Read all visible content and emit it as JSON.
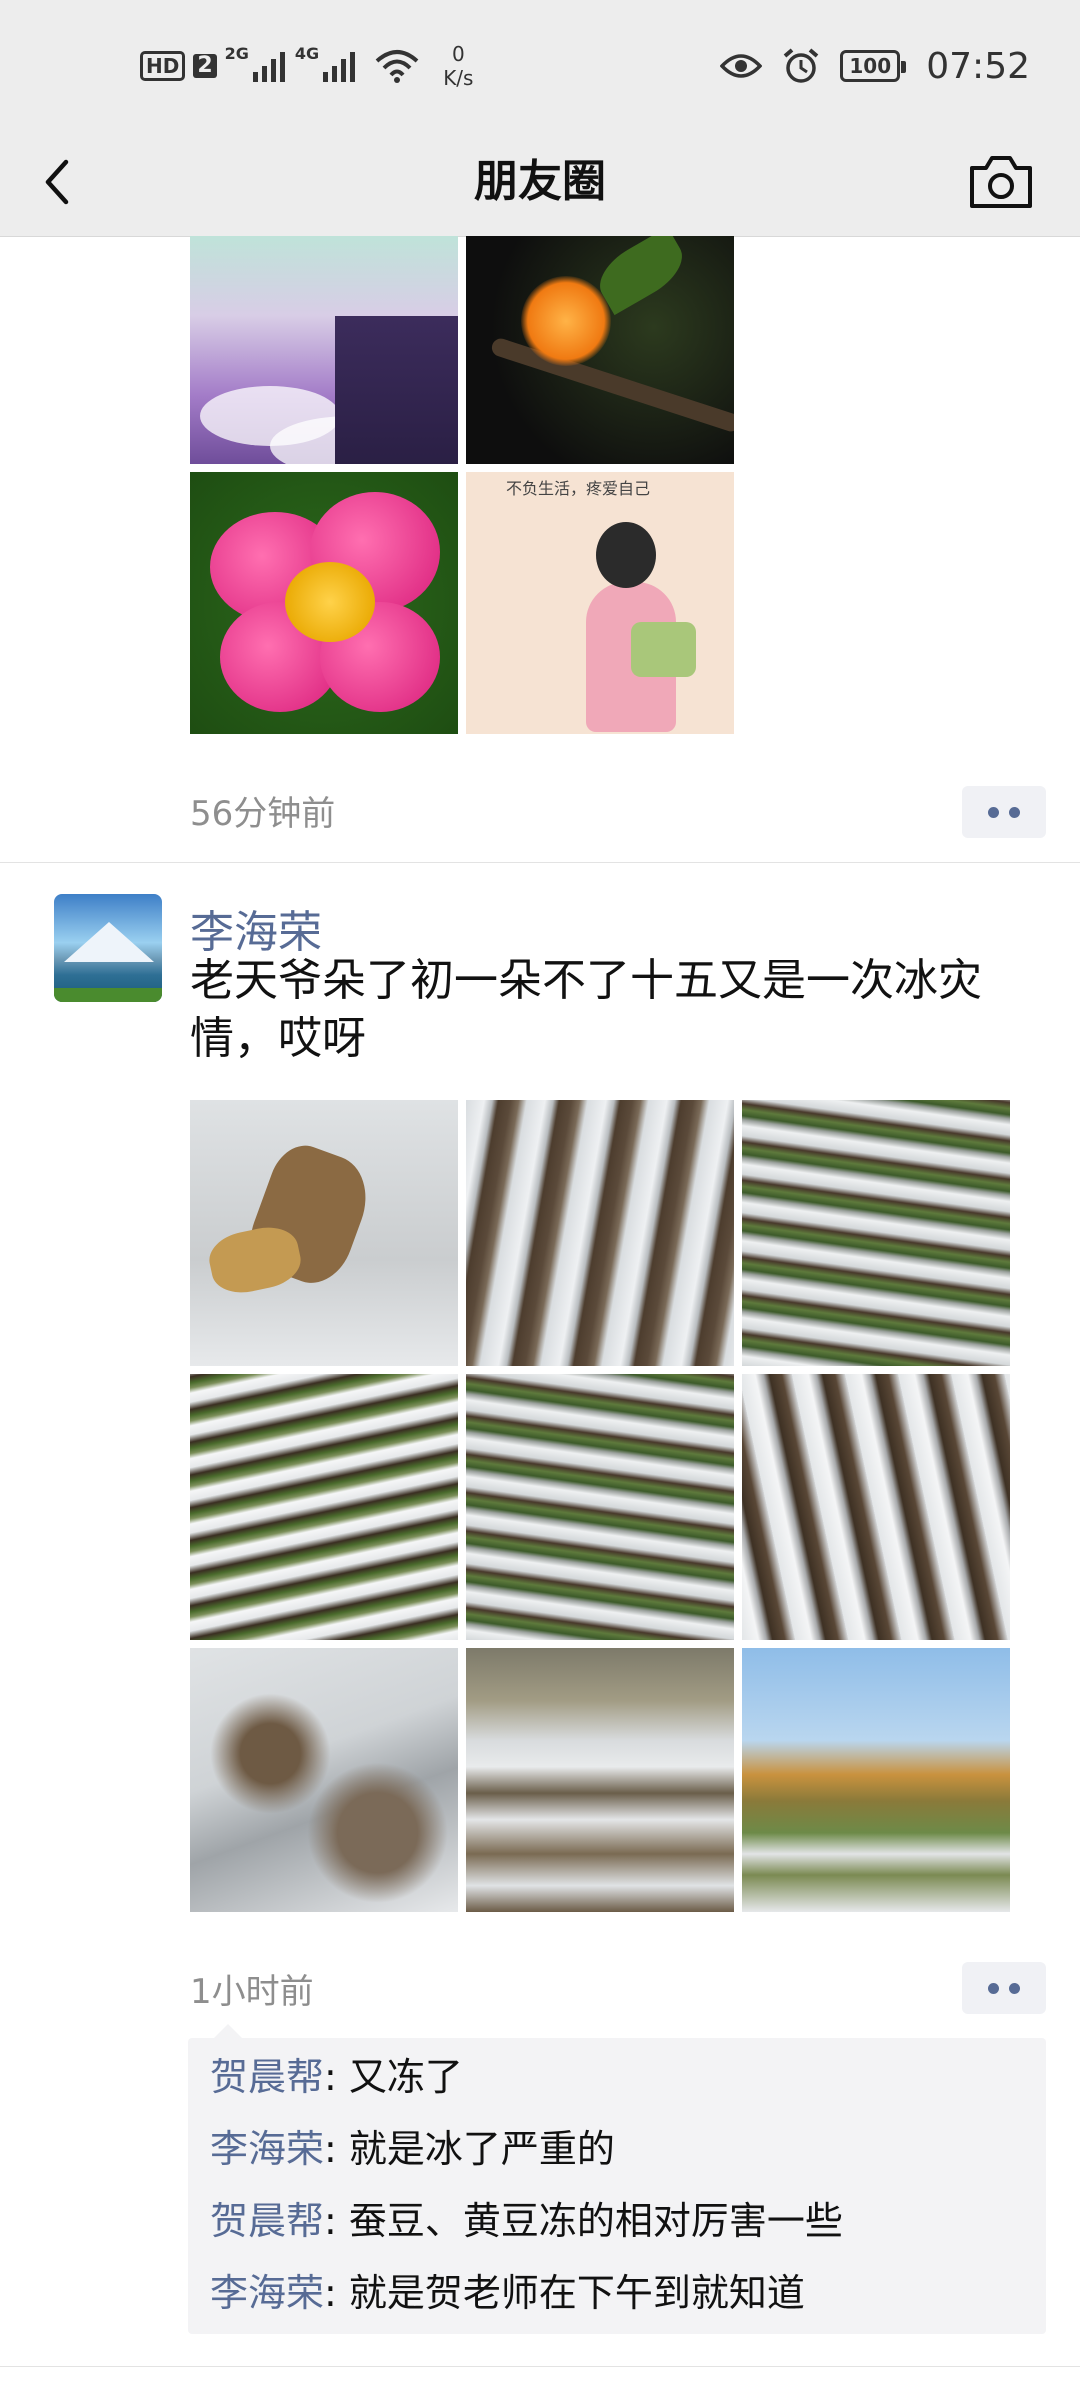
{
  "status_bar": {
    "hd": "HD",
    "sim": "2",
    "net1": "2G",
    "net2": "4G",
    "speed_value": "0",
    "speed_unit": "K/s",
    "battery": "100",
    "time": "07:52"
  },
  "nav": {
    "title": "朋友圈",
    "back_icon": "chevron-left-icon",
    "camera_icon": "camera-icon"
  },
  "post1": {
    "time": "56分钟前",
    "images": [
      "quote-cliff-illustration",
      "orange-flower-photo",
      "pink-peony-photo",
      "girl-illustration"
    ],
    "image4_caption": "不负生活，疼爱自己"
  },
  "post2": {
    "author": "李海荣",
    "text": "老天爷朵了初一朵不了十五又是一次冰灾情，哎呀",
    "time": "1小时前",
    "images": [
      "frozen-crop-closeup",
      "plastic-film-rows",
      "seedling-rows",
      "seedling-rows-2",
      "seedling-field",
      "film-rows-2",
      "muddy-film",
      "hillside-field",
      "field-at-sunset"
    ],
    "comments": [
      {
        "name": "贺晨帮",
        "text": "又冻了"
      },
      {
        "name": "李海荣",
        "text": "就是冰了严重的"
      },
      {
        "name": "贺晨帮",
        "text": "蚕豆、黄豆冻的相对厉害一些"
      },
      {
        "name": "李海荣",
        "text": "就是贺老师在下午到就知道"
      }
    ]
  },
  "colors": {
    "name_link": "#576b95",
    "bar_bg": "#ededed",
    "comment_bg": "#f3f3f5"
  }
}
